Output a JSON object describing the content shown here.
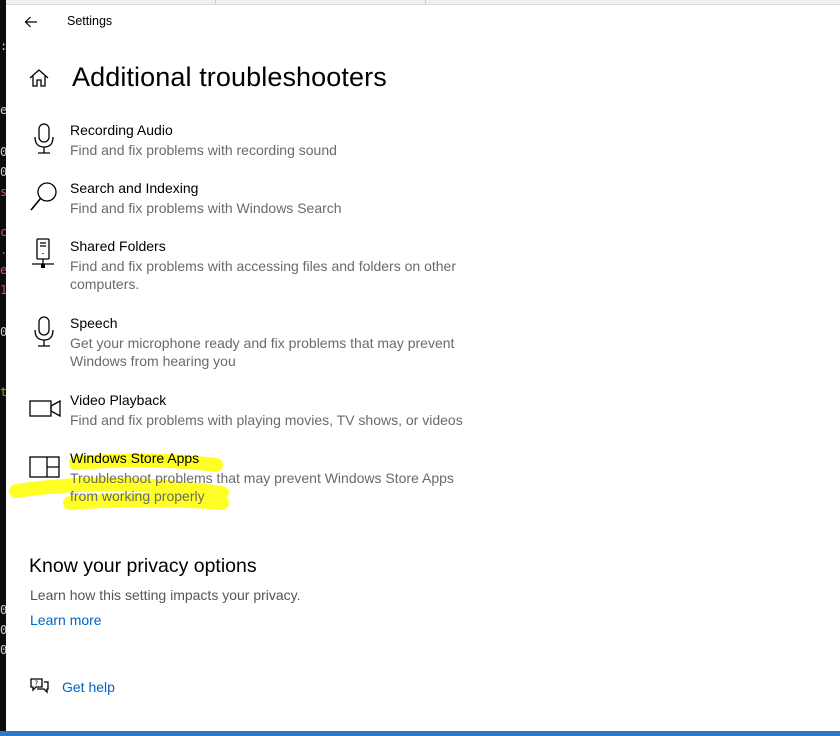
{
  "window": {
    "title": "Settings"
  },
  "page": {
    "title": "Additional troubleshooters"
  },
  "troubleshooters": [
    {
      "name": "Recording Audio",
      "description": "Find and fix problems with recording sound",
      "icon": "microphone-icon"
    },
    {
      "name": "Search and Indexing",
      "description": "Find and fix problems with Windows Search",
      "icon": "search-icon"
    },
    {
      "name": "Shared Folders",
      "description": "Find and fix problems with accessing files and folders on other computers.",
      "icon": "network-share-icon"
    },
    {
      "name": "Speech",
      "description": "Get your microphone ready and fix problems that may prevent Windows from hearing you",
      "icon": "microphone-icon"
    },
    {
      "name": "Video Playback",
      "description": "Find and fix problems with playing movies, TV shows, or videos",
      "icon": "video-camera-icon"
    },
    {
      "name": "Windows Store Apps",
      "description": "Troubleshoot problems that may prevent Windows Store Apps from working properly",
      "icon": "store-apps-icon"
    }
  ],
  "privacy": {
    "title": "Know your privacy options",
    "text": "Learn how this setting impacts your privacy.",
    "link": "Learn more"
  },
  "help": {
    "label": "Get help"
  },
  "colors": {
    "link": "#0064c8",
    "highlight": "#ffff00",
    "secondary_text": "#6a6a6a"
  }
}
